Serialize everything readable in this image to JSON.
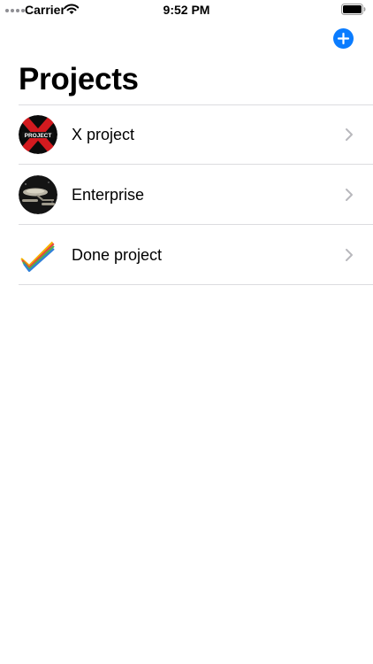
{
  "status_bar": {
    "carrier": "Carrier",
    "time": "9:52 PM"
  },
  "header": {
    "title": "Projects",
    "add_icon": "plus-circle-fill-icon",
    "accent_color": "#0a7cff"
  },
  "projects": [
    {
      "name": "X project",
      "icon": "x-project-avatar"
    },
    {
      "name": "Enterprise",
      "icon": "enterprise-ship-avatar"
    },
    {
      "name": "Done project",
      "icon": "checkmark-logo-avatar"
    }
  ]
}
